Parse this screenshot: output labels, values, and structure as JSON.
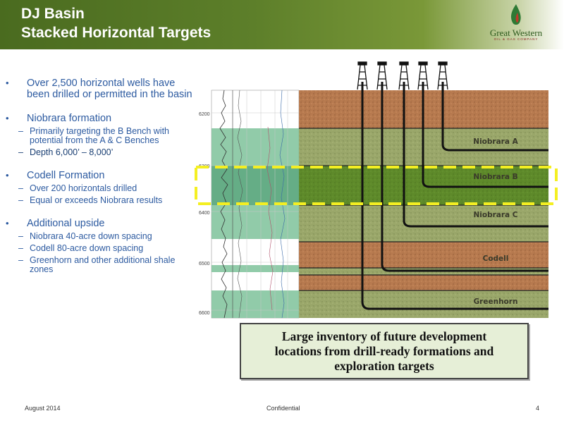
{
  "header": {
    "title_line1": "DJ Basin",
    "title_line2": "Stacked Horizontal Targets",
    "logo_name": "Great Western",
    "logo_sub": "OIL & GAS COMPANY"
  },
  "bullets": [
    {
      "text": "Over 2,500 horizontal wells have been drilled or permitted in the basin",
      "subs": []
    },
    {
      "text": "Niobrara formation",
      "subs": [
        "Primarily targeting the B Bench with potential from the A & C Benches",
        "Depth 6,000’ – 8,000’"
      ]
    },
    {
      "text": "Codell Formation",
      "subs": [
        "Over 200 horizontals drilled",
        "Equal or exceeds Niobrara results"
      ]
    },
    {
      "text": "Additional upside",
      "subs": [
        "Niobrara 40-acre down spacing",
        "Codell 80-acre down spacing",
        "Greenhorn and other additional shale zones"
      ]
    }
  ],
  "diagram": {
    "depth_labels": [
      "6200",
      "6300",
      "6400",
      "6500",
      "6600"
    ],
    "formations": [
      "Niobrara A",
      "Niobrara B",
      "Niobrara C",
      "Codell",
      "Greenhorn"
    ]
  },
  "callout": {
    "line1": "Large inventory of future development",
    "line2": "locations from drill-ready formations and",
    "line3": "exploration targets"
  },
  "footer": {
    "date": "August 2014",
    "confidential": "Confidential",
    "page": "4"
  },
  "colors": {
    "header_green": "#5d7f2a",
    "bullet_blue": "#2c5aa0",
    "highlight_yellow": "#f4ef22",
    "brown_layer": "#b77a4f",
    "green_layer": "#9aa76a",
    "target_green": "#5e8a2a"
  }
}
